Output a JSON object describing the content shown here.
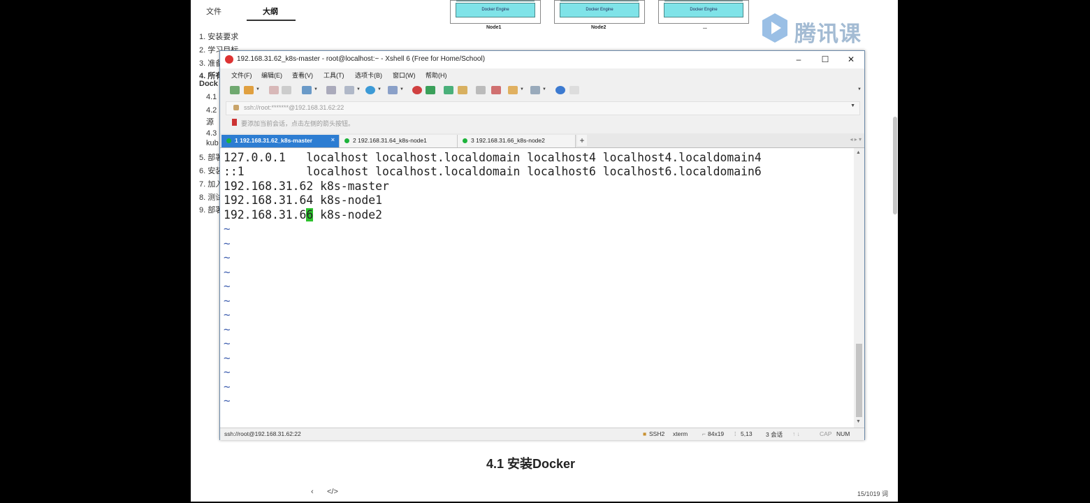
{
  "outline": {
    "tabs": [
      "文件",
      "大纲"
    ],
    "items": [
      "1. 安装要求",
      "2. 学习目标",
      "3. 准备",
      "4. 所有",
      "Dock",
      "4.1",
      "4.2",
      "源",
      "4.3",
      "kub",
      "5. 部署",
      "6. 安装",
      "7. 加入",
      "8. 测试",
      "9. 部署"
    ]
  },
  "diagram": {
    "engine_label": "Docker Engine",
    "nodes": [
      "Node1",
      "Node2",
      "..."
    ]
  },
  "watermark": {
    "text": "腾讯课堂"
  },
  "doc": {
    "heading": "4.1 安装Docker",
    "word_count": "15/1019 词"
  },
  "xshell": {
    "title": "192.168.31.62_k8s-master - root@localhost:~ - Xshell 6 (Free for Home/School)",
    "window_buttons": {
      "minimize": "–",
      "maximize": "☐",
      "close": "✕"
    },
    "menu": [
      "文件(F)",
      "编辑(E)",
      "查看(V)",
      "工具(T)",
      "选项卡(B)",
      "窗口(W)",
      "帮助(H)"
    ],
    "address": "ssh://root:*******@192.168.31.62:22",
    "hint": "要添加当前会话，点击左侧的箭头按钮。",
    "tabs": [
      {
        "label": "1 192.168.31.62_k8s-master",
        "active": true
      },
      {
        "label": "2 192.168.31.64_k8s-node1",
        "active": false
      },
      {
        "label": "3 192.168.31.66_k8s-node2",
        "active": false
      }
    ],
    "tab_add": "+",
    "terminal": {
      "lines": [
        "127.0.0.1   localhost localhost.localdomain localhost4 localhost4.localdomain4",
        "::1         localhost localhost.localdomain localhost6 localhost6.localdomain6",
        "192.168.31.62 k8s-master",
        "192.168.31.64 k8s-node1"
      ],
      "cursor_line": {
        "before": "192.168.31.6",
        "cursor": "6",
        "after": " k8s-node2"
      },
      "tilde": "~",
      "tilde_count": 13
    },
    "status": {
      "connection": "ssh://root@192.168.31.62:22",
      "protocol": "SSH2",
      "term": "xterm",
      "size": "84x19",
      "position": "5,13",
      "sessions": "3 会话",
      "cap": "CAP",
      "num": "NUM"
    }
  },
  "colors": {
    "active_tab": "#2d7dd2",
    "session_dot": "#1db33b",
    "cursor": "#2cc12c",
    "tilde": "#4060b0",
    "engine_fill": "#7fe3e8"
  }
}
